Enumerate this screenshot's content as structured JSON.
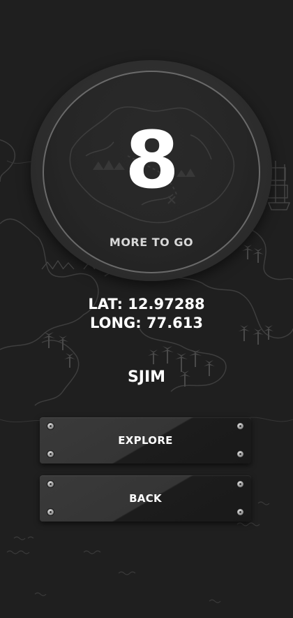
{
  "dial": {
    "remaining_count": "8",
    "remaining_label": "MORE TO GO"
  },
  "location": {
    "latitude_text": "LAT: 12.97288",
    "longitude_text": "LONG: 77.613"
  },
  "player": {
    "name": "SJIM"
  },
  "buttons": {
    "explore_label": "EXPLORE",
    "back_label": "BACK"
  },
  "theme": {
    "background": "#1f1f1f",
    "text": "#ffffff",
    "map_lines": "#4a4a4a"
  }
}
